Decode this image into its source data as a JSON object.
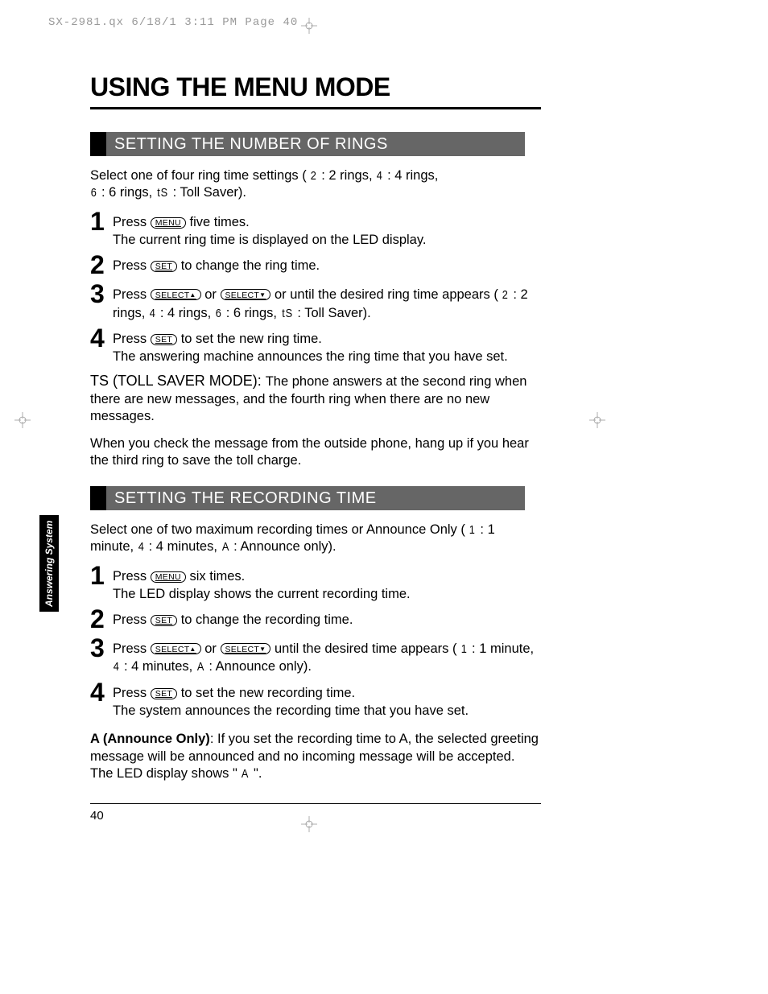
{
  "header": "SX-2981.qx  6/18/1 3:11 PM  Page 40",
  "title": "USING THE MENU MODE",
  "sidebar": "Answering System",
  "buttons": {
    "menu": "MENU",
    "set": "SET",
    "select_up": "SELECT",
    "select_down": "SELECT"
  },
  "section1": {
    "heading": "SETTING THE NUMBER OF RINGS",
    "intro_a": "Select one of four ring time settings (",
    "intro_b": ": 2 rings, ",
    "intro_c": ": 4 rings,",
    "intro_d": ": 6 rings, ",
    "intro_e": ": Toll Saver).",
    "seg2": "2",
    "seg4": "4",
    "seg6": "6",
    "segTS": "tS",
    "step1a": "Press ",
    "step1b": " five times.",
    "step1c": "The current ring time is displayed on the LED display.",
    "step2a": "Press ",
    "step2b": " to change the ring time.",
    "step3a": "Press ",
    "step3b": " or ",
    "step3c": " or until the desired ring time appears (",
    "step3d": ": 2 rings, ",
    "step3e": ": 4 rings, ",
    "step3f": ": 6 rings, ",
    "step3g": ": Toll Saver).",
    "step4a": "Press ",
    "step4b": " to set the new ring time.",
    "step4c": "The answering machine announces the ring time that you have set.",
    "ts_label": "TS (TOLL SAVER MODE): ",
    "ts_body": "The phone answers at the second ring when there are new messages, and the fourth ring when there are no new messages.",
    "ts_note": "When you check the message from the outside phone, hang up if you hear the third ring to save the toll charge."
  },
  "section2": {
    "heading": "SETTING THE RECORDING TIME",
    "intro_a": "Select one of two maximum recording times or Announce Only (",
    "intro_b": ": 1 minute, ",
    "intro_c": ": 4 minutes, ",
    "intro_d": ":  Announce only).",
    "seg1": "1",
    "seg4": "4",
    "segA": "A",
    "step1a": "Press ",
    "step1b": " six times.",
    "step1c": "The LED display shows the current recording time.",
    "step2a": "Press ",
    "step2b": " to change the recording time.",
    "step3a": "Press ",
    "step3b": " or ",
    "step3c": " until the desired time appears (",
    "step3d": ": 1 minute, ",
    "step3e": ": 4 minutes, ",
    "step3f": ":  Announce only).",
    "step4a": "Press ",
    "step4b": " to set the new recording time.",
    "step4c": "The system announces the recording time that you have set.",
    "a_label": "A (Announce Only)",
    "a_body_a": ": If you set the recording time to A, the selected greeting message will be announced and no incoming message will be accepted. The LED display shows \" ",
    "a_body_b": " \"."
  },
  "page_number": "40"
}
